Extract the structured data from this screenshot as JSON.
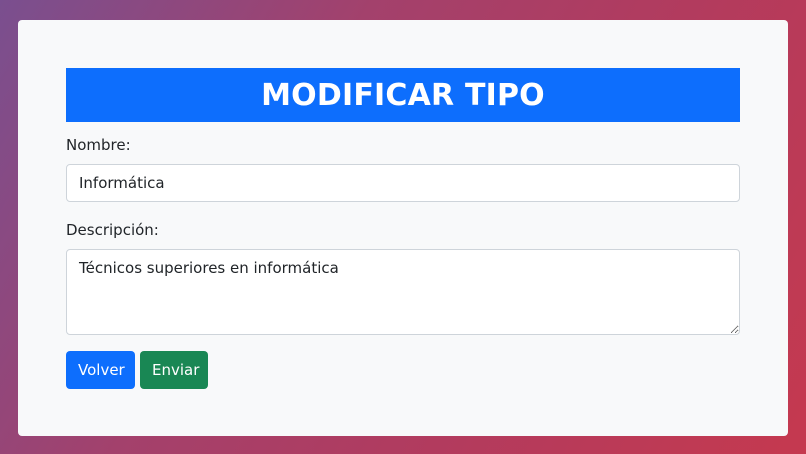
{
  "form": {
    "title": "MODIFICAR TIPO",
    "nombre_label": "Nombre:",
    "nombre_value": "Informática",
    "descripcion_label": "Descripción:",
    "descripcion_value": "Técnicos superiores en informática",
    "back_label": "Volver",
    "submit_label": "Enviar"
  },
  "colors": {
    "title_bg": "#0d6efd",
    "back_button": "#0d6efd",
    "submit_button": "#198754",
    "card_bg": "#f8f9fa"
  }
}
